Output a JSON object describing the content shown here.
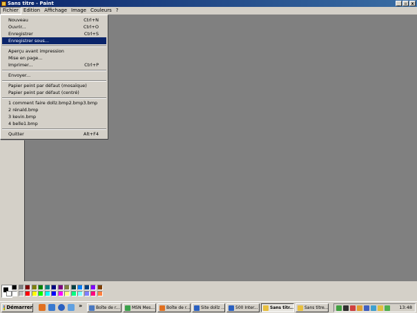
{
  "window": {
    "title": "Sans titre - Paint",
    "minimize_glyph": "_",
    "maximize_glyph": "▫",
    "close_glyph": "x"
  },
  "menubar": [
    "Fichier",
    "Edition",
    "Affichage",
    "Image",
    "Couleurs",
    "?"
  ],
  "file_menu": {
    "items": [
      {
        "label": "Nouveau",
        "shortcut": "Ctrl+N"
      },
      {
        "label": "Ouvrir...",
        "shortcut": "Ctrl+O"
      },
      {
        "label": "Enregistrer",
        "shortcut": "Ctrl+S"
      },
      {
        "label": "Enregistrer sous...",
        "shortcut": "",
        "highlighted": true
      },
      {
        "label": "Aperçu avant impression",
        "shortcut": ""
      },
      {
        "label": "Mise en page...",
        "shortcut": ""
      },
      {
        "label": "Imprimer...",
        "shortcut": "Ctrl+P"
      },
      {
        "label": "Envoyer...",
        "shortcut": ""
      },
      {
        "label": "Papier peint par défaut (mosaïque)",
        "shortcut": ""
      },
      {
        "label": "Papier peint par défaut (centré)",
        "shortcut": ""
      },
      {
        "label": "1 comment faire dollz.bmp2.bmp3.bmp",
        "shortcut": ""
      },
      {
        "label": "2 rénald.bmp",
        "shortcut": ""
      },
      {
        "label": "3 kevin.bmp",
        "shortcut": ""
      },
      {
        "label": "4 belle1.bmp",
        "shortcut": ""
      },
      {
        "label": "Quitter",
        "shortcut": "Alt+F4"
      }
    ]
  },
  "palette": {
    "foreground": "#000000",
    "background": "#ffffff",
    "colors_top": [
      "#000000",
      "#808080",
      "#800000",
      "#808000",
      "#008000",
      "#008080",
      "#000080",
      "#800080",
      "#808040",
      "#004040",
      "#0080ff",
      "#004080",
      "#8000ff",
      "#804000"
    ],
    "colors_bottom": [
      "#ffffff",
      "#c0c0c0",
      "#ff0000",
      "#ffff00",
      "#00ff00",
      "#00ffff",
      "#0000ff",
      "#ff00ff",
      "#ffff80",
      "#00ff80",
      "#80ffff",
      "#8080ff",
      "#ff0080",
      "#ff8040"
    ]
  },
  "taskbar": {
    "start_label": "Démarrer",
    "overflow_glyph": "»",
    "tasks": [
      {
        "label": "Boîte de r...",
        "color": "#4a78c0",
        "active": false
      },
      {
        "label": "MSN Mes...",
        "color": "#3aa04a",
        "active": false
      },
      {
        "label": "Boîte de r...",
        "color": "#e07020",
        "active": false
      },
      {
        "label": "Site dollz ...",
        "color": "#2a60c0",
        "active": false
      },
      {
        "label": "500 Inter...",
        "color": "#2a60c0",
        "active": false
      },
      {
        "label": "Sans titr...",
        "color": "#e8c040",
        "active": true
      },
      {
        "label": "Sans titre...",
        "color": "#e8c040",
        "active": false
      }
    ],
    "clock": "13:48"
  }
}
